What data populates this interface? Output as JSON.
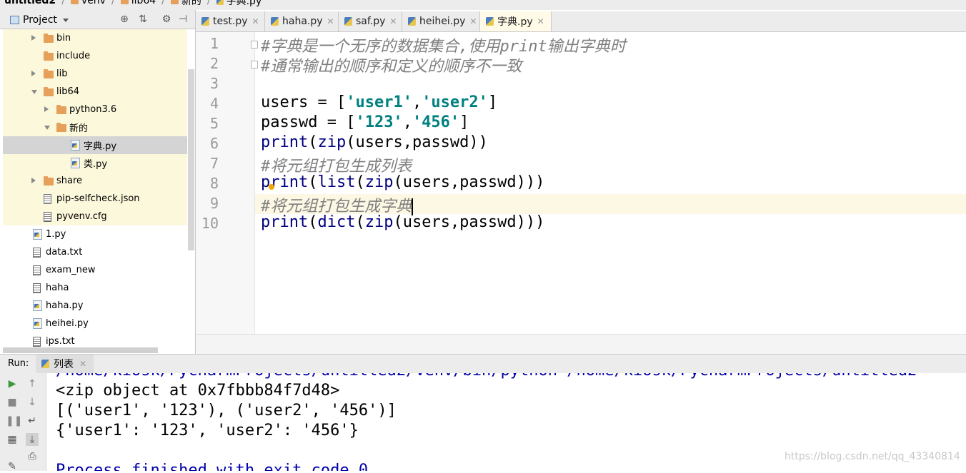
{
  "breadcrumb": {
    "items": [
      "untitled2",
      "venv",
      "lib64",
      "新的",
      "字典.py"
    ]
  },
  "project_panel": {
    "title": "Project",
    "tree": [
      {
        "label": "bin",
        "type": "folder",
        "depth": 2,
        "expanded": false,
        "yellow": true
      },
      {
        "label": "include",
        "type": "folder",
        "depth": 2,
        "expanded": null,
        "yellow": true
      },
      {
        "label": "lib",
        "type": "folder",
        "depth": 2,
        "expanded": false,
        "yellow": true
      },
      {
        "label": "lib64",
        "type": "folder",
        "depth": 2,
        "expanded": true,
        "yellow": true
      },
      {
        "label": "python3.6",
        "type": "folder",
        "depth": 3,
        "expanded": false,
        "yellow": true
      },
      {
        "label": "新的",
        "type": "folder",
        "depth": 3,
        "expanded": true,
        "yellow": true
      },
      {
        "label": "字典.py",
        "type": "py",
        "depth": 4,
        "selected": true
      },
      {
        "label": "类.py",
        "type": "py",
        "depth": 4,
        "yellow": true
      },
      {
        "label": "share",
        "type": "folder",
        "depth": 2,
        "expanded": false,
        "yellow": true
      },
      {
        "label": "pip-selfcheck.json",
        "type": "json",
        "depth": 2,
        "yellow": true
      },
      {
        "label": "pyvenv.cfg",
        "type": "txt",
        "depth": 2,
        "yellow": true
      },
      {
        "label": "1.py",
        "type": "py",
        "depth": 1
      },
      {
        "label": "data.txt",
        "type": "txt",
        "depth": 1
      },
      {
        "label": "exam_new",
        "type": "txt",
        "depth": 1
      },
      {
        "label": "haha",
        "type": "txt",
        "depth": 1
      },
      {
        "label": "haha.py",
        "type": "py",
        "depth": 1
      },
      {
        "label": "heihei.py",
        "type": "py",
        "depth": 1
      },
      {
        "label": "ips.txt",
        "type": "txt",
        "depth": 1
      }
    ]
  },
  "editor_tabs": [
    {
      "label": "test.py",
      "active": false
    },
    {
      "label": "haha.py",
      "active": false
    },
    {
      "label": "saf.py",
      "active": false
    },
    {
      "label": "heihei.py",
      "active": false
    },
    {
      "label": "字典.py",
      "active": true
    }
  ],
  "editor": {
    "line_numbers": [
      "1",
      "2",
      "3",
      "4",
      "5",
      "6",
      "7",
      "8",
      "9",
      "10"
    ],
    "current_line": 9,
    "lines": [
      [
        {
          "t": "#字典是一个无序的数据集合,使用print输出字典时",
          "c": "comment"
        }
      ],
      [
        {
          "t": "#通常输出的顺序和定义的顺序不一致",
          "c": "comment"
        }
      ],
      [],
      [
        {
          "t": "users = [",
          "c": "txt"
        },
        {
          "t": "'user1'",
          "c": "str"
        },
        {
          "t": ",",
          "c": "txt"
        },
        {
          "t": "'user2'",
          "c": "str"
        },
        {
          "t": "]",
          "c": "txt"
        }
      ],
      [
        {
          "t": "passwd = [",
          "c": "txt"
        },
        {
          "t": "'123'",
          "c": "str"
        },
        {
          "t": ",",
          "c": "txt"
        },
        {
          "t": "'456'",
          "c": "str"
        },
        {
          "t": "]",
          "c": "txt"
        }
      ],
      [
        {
          "t": "print",
          "c": "kw"
        },
        {
          "t": "(",
          "c": "txt"
        },
        {
          "t": "zip",
          "c": "kw"
        },
        {
          "t": "(users,passwd))",
          "c": "txt"
        }
      ],
      [
        {
          "t": "#将元组打包生成列表",
          "c": "comment"
        }
      ],
      [
        {
          "t": "print",
          "c": "kw"
        },
        {
          "t": "(",
          "c": "txt"
        },
        {
          "t": "list",
          "c": "kw"
        },
        {
          "t": "(",
          "c": "txt"
        },
        {
          "t": "zip",
          "c": "kw"
        },
        {
          "t": "(users,passwd)))",
          "c": "txt"
        }
      ],
      [
        {
          "t": "#将元组打包生成字典",
          "c": "comment"
        }
      ],
      [
        {
          "t": "print",
          "c": "kw"
        },
        {
          "t": "(",
          "c": "txt"
        },
        {
          "t": "dict",
          "c": "kw"
        },
        {
          "t": "(",
          "c": "txt"
        },
        {
          "t": "zip",
          "c": "kw"
        },
        {
          "t": "(users,passwd)))",
          "c": "txt"
        }
      ]
    ]
  },
  "run_panel": {
    "label": "Run:",
    "tab_label": "列表",
    "output": [
      {
        "text": "/home/kiosk/PycharmProjects/untitled2/venv/bin/python /home/kiosk/PycharmProjects/untitled2",
        "style": "blue"
      },
      {
        "text": "<zip object at 0x7fbbb84f7d48>",
        "style": "normal"
      },
      {
        "text": "[('user1', '123'), ('user2', '456')]",
        "style": "normal"
      },
      {
        "text": "{'user1': '123', 'user2': '456'}",
        "style": "normal"
      },
      {
        "text": "",
        "style": "normal"
      },
      {
        "text": "Process finished with exit code 0",
        "style": "blue"
      }
    ]
  },
  "watermark": "https://blog.csdn.net/qq_43340814",
  "colors": {
    "keyword": "#000080",
    "string": "#008080",
    "comment": "#7f7f7f",
    "venv_highlight": "#fcf8db",
    "current_line": "#fdf8e4"
  },
  "icons": [
    "project-icon",
    "locate-icon",
    "collapse-icon",
    "gear-icon",
    "folder-icon",
    "py-file-icon",
    "text-file-icon",
    "run-icon",
    "stop-icon",
    "pause-icon",
    "scroll-up-icon",
    "scroll-down-icon",
    "wrap-icon",
    "scroll-end-icon",
    "print-icon",
    "layout-icon",
    "pin-icon",
    "bulb-icon"
  ]
}
